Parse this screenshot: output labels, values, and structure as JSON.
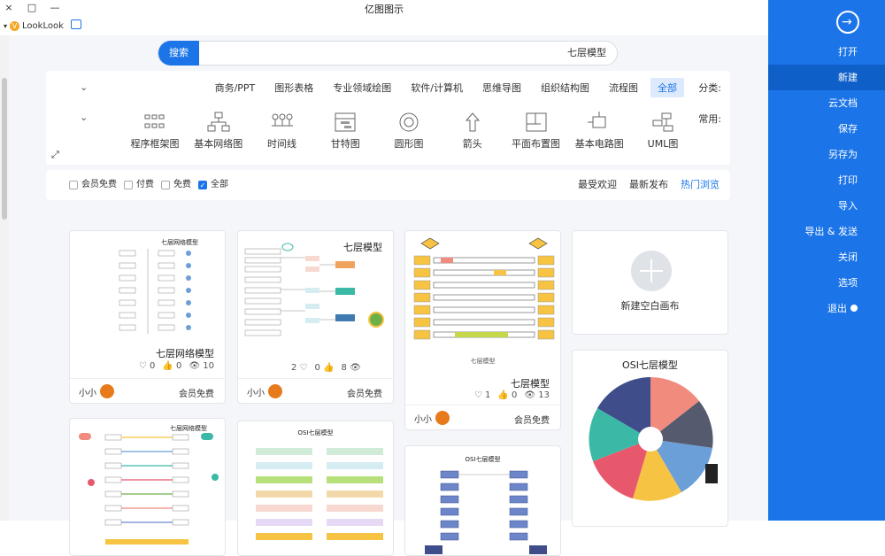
{
  "window": {
    "title": "亿图图示",
    "controls": [
      "×",
      "□",
      "—"
    ],
    "account": "LookLook"
  },
  "search": {
    "button": "搜索",
    "query": "七层模型"
  },
  "filters": {
    "category_label": "分类:",
    "categories": [
      "全部",
      "流程图",
      "组织结构图",
      "思维导图",
      "软件/计算机",
      "专业领域绘图",
      "图形表格",
      "商务/PPT"
    ],
    "common_label": "常用:",
    "common": [
      {
        "label": "UML图",
        "icon": "uml-icon"
      },
      {
        "label": "基本电路图",
        "icon": "circuit-icon"
      },
      {
        "label": "平面布置图",
        "icon": "floorplan-icon"
      },
      {
        "label": "箭头",
        "icon": "arrow-icon"
      },
      {
        "label": "圆形图",
        "icon": "circle-diagram-icon"
      },
      {
        "label": "甘特图",
        "icon": "gantt-icon"
      },
      {
        "label": "时间线",
        "icon": "timeline-icon"
      },
      {
        "label": "基本网络图",
        "icon": "network-icon"
      },
      {
        "label": "程序框架图",
        "icon": "program-frame-icon"
      }
    ]
  },
  "sort": {
    "tabs": [
      "热门浏览",
      "最新发布",
      "最受欢迎"
    ],
    "checks": [
      {
        "label": "全部",
        "checked": true
      },
      {
        "label": "免费",
        "checked": false
      },
      {
        "label": "付费",
        "checked": false
      },
      {
        "label": "会员免费",
        "checked": false
      }
    ]
  },
  "cards": {
    "new_blank": "新建空白画布",
    "items": [
      {
        "title": "七层模型",
        "views": "13",
        "likes": "0",
        "comments": "1",
        "author": "小小",
        "price": "会员免费"
      },
      {
        "title": "七层模型",
        "views": "8",
        "likes": "0",
        "comments": "2",
        "author": "小小",
        "price": "会员免费"
      },
      {
        "title": "七层网络模型",
        "views": "10",
        "likes": "0",
        "comments": "0",
        "author": "小小",
        "price": "会员免费"
      },
      {
        "title": "OSI七层模型"
      },
      {
        "title": "OSI七层模型"
      },
      {
        "title": "OSI七层模型"
      },
      {
        "title": "七层网络模型"
      }
    ]
  },
  "sidebar": {
    "items": [
      "打开",
      "新建",
      "云文档",
      "保存",
      "另存为",
      "打印",
      "导入",
      "导出 & 发送",
      "关闭",
      "选项",
      "退出"
    ],
    "active": "新建"
  }
}
